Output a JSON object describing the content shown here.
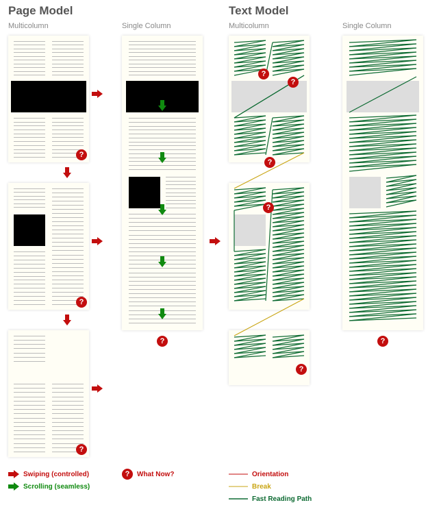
{
  "titles": {
    "page_model": "Page Model",
    "text_model": "Text Model"
  },
  "subtitles": {
    "pm_multi": "Multicolumn",
    "pm_single": "Single Column",
    "tm_multi": "Multicolumn",
    "tm_single": "Single Column"
  },
  "legend_left": {
    "swiping": "Swiping (controlled)",
    "scrolling": "Scrolling (seamless)",
    "what_now": "What Now?"
  },
  "legend_right": {
    "orientation": "Orientation",
    "break": "Break",
    "fast_reading": "Fast Reading Path"
  },
  "colors": {
    "red": "#c30e0e",
    "green_arrow": "#108a10",
    "green_path": "#0e6b33",
    "yellow": "#c9a514",
    "grey_text": "#888",
    "dark_title": "#555"
  },
  "qmark_glyph": "?",
  "chart_data": {
    "type": "diagram",
    "title": "Page Model vs Text Model — reading flow illustration",
    "left_group": {
      "name": "Page Model",
      "columns": [
        {
          "name": "Multicolumn",
          "page_count": 3,
          "pages": [
            {
              "columns": 2,
              "image_block": "full-width upper",
              "swipe_right": true,
              "confusion_points": 1
            },
            {
              "columns": 2,
              "image_block": "left-column mid",
              "swipe_right": true,
              "confusion_points": 1
            },
            {
              "columns": 2,
              "image_block": "none",
              "swipe_right": true,
              "confusion_points": 1
            }
          ],
          "swipe_down_between_pages": 2
        },
        {
          "name": "Single Column",
          "page_count": 1,
          "pages": [
            {
              "columns": 1,
              "image_blocks": [
                "full-width upper",
                "half-width mid"
              ],
              "scroll_arrows": 5,
              "confusion_points": 1
            }
          ]
        }
      ]
    },
    "right_group": {
      "name": "Text Model",
      "columns": [
        {
          "name": "Multicolumn",
          "page_count": 3,
          "pages": [
            {
              "fast_reading_path": true,
              "orientation_lines": 4,
              "break_lines": 0,
              "grey_blocks": 1,
              "confusion_points": 2
            },
            {
              "fast_reading_path": true,
              "orientation_lines": 2,
              "break_lines": 1,
              "grey_blocks": 1,
              "confusion_points": 1
            },
            {
              "fast_reading_path": "partial",
              "orientation_lines": 0,
              "break_lines": 1,
              "confusion_points": 1
            }
          ],
          "swipe_right_between_cols": true
        },
        {
          "name": "Single Column",
          "page_count": 1,
          "pages": [
            {
              "fast_reading_path": true,
              "break_lines": 1,
              "grey_blocks": 2,
              "confusion_points": 1
            }
          ]
        }
      ]
    },
    "legend": {
      "red_arrow": "Swiping (controlled)",
      "green_arrow": "Scrolling (seamless)",
      "red_circle_q": "What Now?",
      "red_line": "Orientation",
      "yellow_line": "Break",
      "green_line": "Fast Reading Path"
    }
  }
}
